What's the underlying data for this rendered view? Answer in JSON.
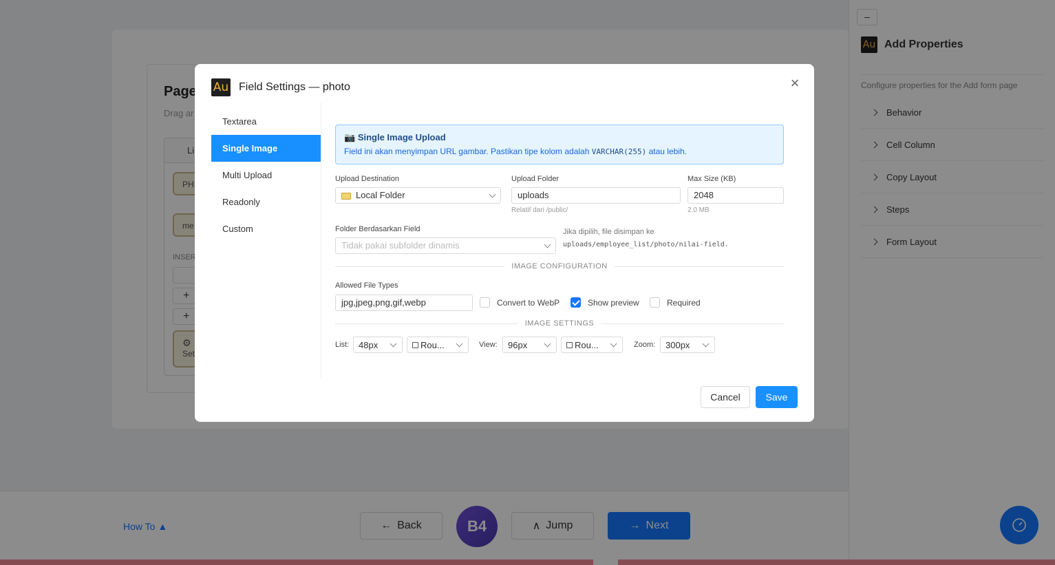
{
  "background": {
    "title": "Page",
    "subtitle": "Drag ar",
    "tab_label": "Li",
    "chip1": "PHI",
    "chip2": "me",
    "insert_label": "INSER",
    "plus": "+",
    "settings_label": "Set"
  },
  "sidebar": {
    "collapse_label": "–",
    "logo_text": "Au",
    "title": "Add Properties",
    "description": "Configure properties for the Add form page",
    "items": [
      {
        "label": "Behavior"
      },
      {
        "label": "Cell Column"
      },
      {
        "label": "Copy Layout"
      },
      {
        "label": "Steps"
      },
      {
        "label": "Form Layout"
      }
    ]
  },
  "bottom_nav": {
    "howto": "How To ▲",
    "back": "Back",
    "badge": "B4",
    "jump": "Jump",
    "next": "Next"
  },
  "modal": {
    "logo_text": "Au",
    "title": "Field Settings — photo",
    "close": "×",
    "nav": [
      {
        "label": "Textarea",
        "active": false
      },
      {
        "label": "Single Image",
        "active": true
      },
      {
        "label": "Multi Upload",
        "active": false
      },
      {
        "label": "Readonly",
        "active": false
      },
      {
        "label": "Custom",
        "active": false
      }
    ],
    "info": {
      "icon": "📷",
      "title": "Single Image Upload",
      "text_before": "Field ini akan menyimpan URL gambar. Pastikan tipe kolom adalah",
      "code": "VARCHAR(255)",
      "text_after": "atau lebih."
    },
    "upload_destination": {
      "label": "Upload Destination",
      "value": "Local Folder"
    },
    "upload_folder": {
      "label": "Upload Folder",
      "value": "uploads",
      "help": "Relatif dari /public/"
    },
    "max_size": {
      "label": "Max Size (KB)",
      "value": "2048",
      "help": "2.0 MB"
    },
    "folder_field": {
      "label": "Folder Berdasarkan Field",
      "placeholder": "Tidak pakai subfolder dinamis",
      "hint": "Jika dipilih, file disimpan ke",
      "path": "uploads/employee_list/photo/nilai-field."
    },
    "section_image_config": "IMAGE CONFIGURATION",
    "allowed_types": {
      "label": "Allowed File Types",
      "value": "jpg,jpeg,png,gif,webp"
    },
    "checkboxes": [
      {
        "label": "Convert to WebP",
        "checked": false
      },
      {
        "label": "Show preview",
        "checked": true
      },
      {
        "label": "Required",
        "checked": false
      }
    ],
    "section_image_settings": "IMAGE SETTINGS",
    "image_settings": {
      "list_label": "List:",
      "list_size": "48px",
      "list_shape": "Rou...",
      "view_label": "View:",
      "view_size": "96px",
      "view_shape": "Rou...",
      "zoom_label": "Zoom:",
      "zoom_size": "300px"
    },
    "cancel": "Cancel",
    "save": "Save"
  }
}
